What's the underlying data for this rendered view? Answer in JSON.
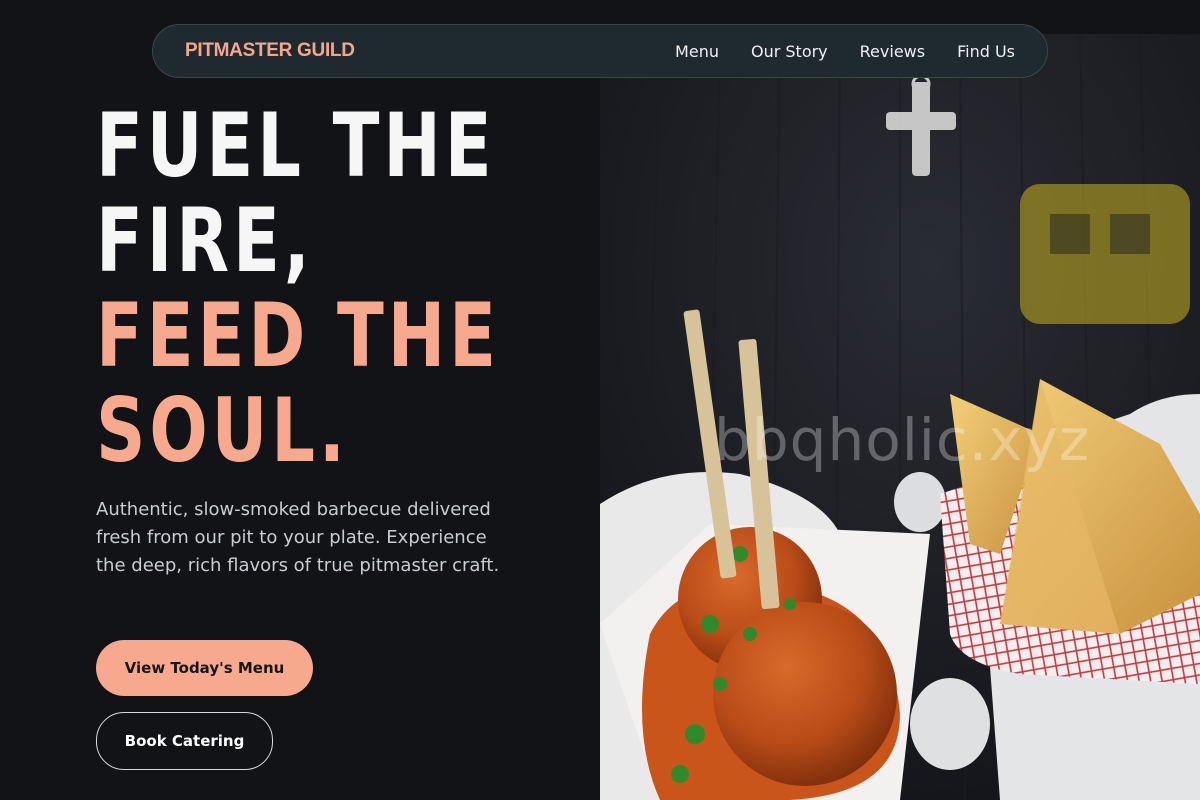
{
  "nav": {
    "brand": "PITMASTER GUILD",
    "links": [
      {
        "label": "Menu"
      },
      {
        "label": "Our Story"
      },
      {
        "label": "Reviews"
      },
      {
        "label": "Find Us"
      }
    ]
  },
  "hero": {
    "headline_lines": [
      "FUEL THE",
      "FIRE,",
      "FEED THE",
      "SOUL."
    ],
    "subcopy": "Authentic, slow-smoked barbecue delivered fresh from our pit to your plate. Experience the deep, rich flavors of true pitmaster craft.",
    "primary_cta": "View Today's Menu",
    "secondary_cta": "Book Catering",
    "photo_watermark": "bbqholic.xyz"
  },
  "colors": {
    "background": "#111317",
    "accent": "#f6a98d",
    "nav_bg": "#1f2a30"
  }
}
